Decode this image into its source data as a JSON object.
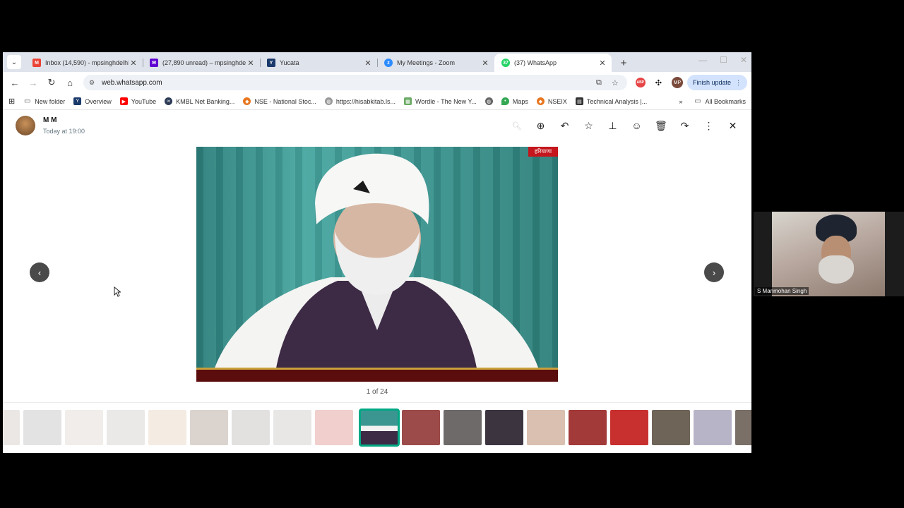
{
  "browser": {
    "tabs": [
      {
        "title": "Inbox (14,590) - mpsinghdelhi@",
        "favicon": "gmail-icon",
        "active": false
      },
      {
        "title": "(27,890 unread) – mpsinghdelhi",
        "favicon": "yahoo-mail-icon",
        "active": false
      },
      {
        "title": "Yucata",
        "favicon": "yucata-icon",
        "active": false
      },
      {
        "title": "My Meetings - Zoom",
        "favicon": "zoom-icon",
        "active": false
      },
      {
        "title": "(37) WhatsApp",
        "favicon": "whatsapp-icon",
        "badge": "37",
        "active": true
      }
    ],
    "url": "web.whatsapp.com",
    "finish_update": "Finish update",
    "profile_initials": "MP",
    "abp_label": "ABP",
    "bookmarks": [
      {
        "label": "New folder",
        "icon": "folder-icon"
      },
      {
        "label": "Overview",
        "icon": "yahoo-finance-icon"
      },
      {
        "label": "YouTube",
        "icon": "youtube-icon"
      },
      {
        "label": "KMBL Net Banking...",
        "icon": "kotak-icon"
      },
      {
        "label": "NSE - National Stoc...",
        "icon": "nse-icon"
      },
      {
        "label": "https://hisabkitab.ls...",
        "icon": "globe-icon"
      },
      {
        "label": "Wordle - The New Y...",
        "icon": "wordle-icon"
      },
      {
        "label": "",
        "icon": "globe-icon"
      },
      {
        "label": "Maps",
        "icon": "maps-icon"
      },
      {
        "label": "NSEIX",
        "icon": "nseix-icon"
      },
      {
        "label": "Technical Analysis |...",
        "icon": "technical-icon"
      }
    ],
    "all_bookmarks": "All Bookmarks"
  },
  "viewer": {
    "sender": "M M",
    "timestamp": "Today at 19:00",
    "counter": "1 of 24",
    "media_badge": "हरियाणा",
    "thumbnail_count": 18,
    "selected_thumbnail": 8
  },
  "zoom": {
    "participant": "S Manmohan Singh"
  },
  "colors": {
    "accent": "#00a884",
    "tabbar": "#dfe3eb",
    "finish_update_bg": "#d3e3fd"
  }
}
